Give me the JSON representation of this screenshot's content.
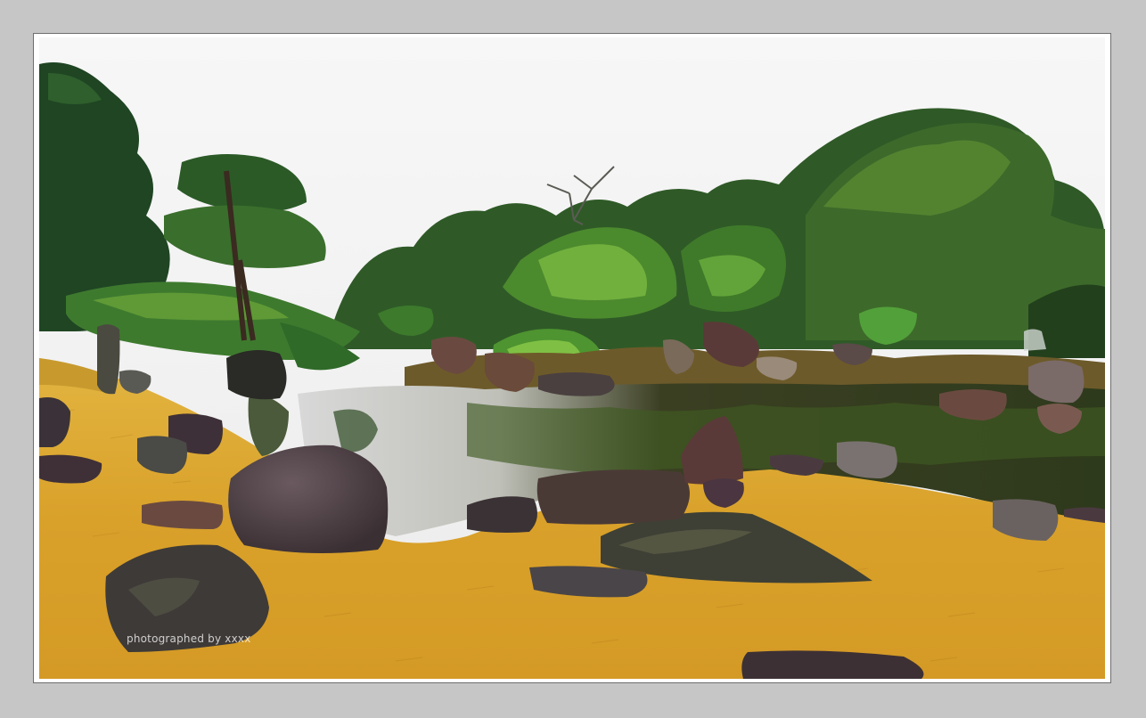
{
  "photo": {
    "subject": "Japanese garden pond with pines, rocks and yellow winter lawn",
    "watermark": "photographed by xxxx"
  },
  "colors": {
    "page_background": "#c6c6c6",
    "frame_background": "#ffffff",
    "sky": "#f2f2f2",
    "lawn": "#dca52c",
    "water": "#3a3a1e",
    "pine_dark": "#1f4a24",
    "pine_light": "#5f9a2e",
    "rock": "#4e3f44"
  }
}
